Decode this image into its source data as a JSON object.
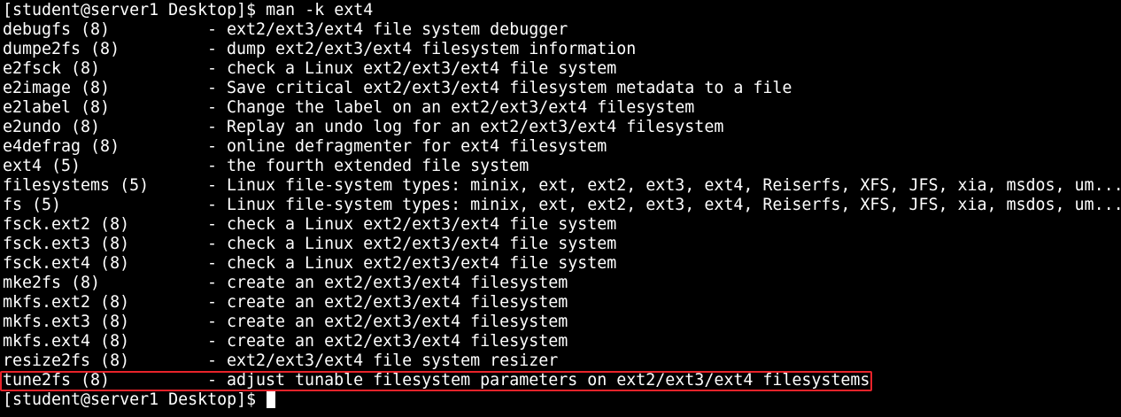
{
  "terminal": {
    "prompt": "[student@server1 Desktop]$ ",
    "command": "man -k ext4",
    "highlight_color": "#e8232a",
    "results": [
      {
        "name": "debugfs (8)",
        "desc": "- ext2/ext3/ext4 file system debugger"
      },
      {
        "name": "dumpe2fs (8)",
        "desc": "- dump ext2/ext3/ext4 filesystem information"
      },
      {
        "name": "e2fsck (8)",
        "desc": "- check a Linux ext2/ext3/ext4 file system"
      },
      {
        "name": "e2image (8)",
        "desc": "- Save critical ext2/ext3/ext4 filesystem metadata to a file"
      },
      {
        "name": "e2label (8)",
        "desc": "- Change the label on an ext2/ext3/ext4 filesystem"
      },
      {
        "name": "e2undo (8)",
        "desc": "- Replay an undo log for an ext2/ext3/ext4 filesystem"
      },
      {
        "name": "e4defrag (8)",
        "desc": "- online defragmenter for ext4 filesystem"
      },
      {
        "name": "ext4 (5)",
        "desc": "- the fourth extended file system"
      },
      {
        "name": "filesystems (5)",
        "desc": "- Linux file-system types: minix, ext, ext2, ext3, ext4, Reiserfs, XFS, JFS, xia, msdos, um..."
      },
      {
        "name": "fs (5)",
        "desc": "- Linux file-system types: minix, ext, ext2, ext3, ext4, Reiserfs, XFS, JFS, xia, msdos, um..."
      },
      {
        "name": "fsck.ext2 (8)",
        "desc": "- check a Linux ext2/ext3/ext4 file system"
      },
      {
        "name": "fsck.ext3 (8)",
        "desc": "- check a Linux ext2/ext3/ext4 file system"
      },
      {
        "name": "fsck.ext4 (8)",
        "desc": "- check a Linux ext2/ext3/ext4 file system"
      },
      {
        "name": "mke2fs (8)",
        "desc": "- create an ext2/ext3/ext4 filesystem"
      },
      {
        "name": "mkfs.ext2 (8)",
        "desc": "- create an ext2/ext3/ext4 filesystem"
      },
      {
        "name": "mkfs.ext3 (8)",
        "desc": "- create an ext2/ext3/ext4 filesystem"
      },
      {
        "name": "mkfs.ext4 (8)",
        "desc": "- create an ext2/ext3/ext4 filesystem"
      },
      {
        "name": "resize2fs (8)",
        "desc": "- ext2/ext3/ext4 file system resizer"
      },
      {
        "name": "tune2fs (8)",
        "desc": "- adjust tunable filesystem parameters on ext2/ext3/ext4 filesystems"
      }
    ],
    "final_prompt": "[student@server1 Desktop]$ "
  }
}
